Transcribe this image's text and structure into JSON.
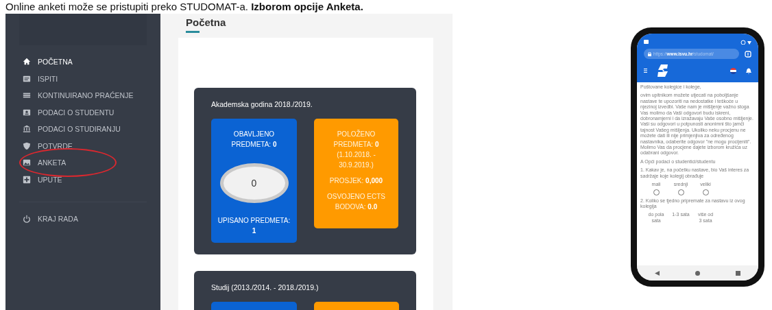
{
  "caption": "Online anketi može se pristupiti preko STUDOMAT-a. **Izborom opcije Anketa.**",
  "sidebar": {
    "items": [
      {
        "label": "POČETNA",
        "selected": true,
        "circled": false
      },
      {
        "label": "ISPITI",
        "selected": false,
        "circled": false
      },
      {
        "label": "KONTINUIRANO PRAĆENJE",
        "selected": false,
        "circled": false
      },
      {
        "label": "PODACI O STUDENTU",
        "selected": false,
        "circled": false
      },
      {
        "label": "PODACI O STUDIRANJU",
        "selected": false,
        "circled": false
      },
      {
        "label": "POTVRDE",
        "selected": false,
        "circled": false
      },
      {
        "label": "ANKETA",
        "selected": false,
        "circled": true
      },
      {
        "label": "UPUTE",
        "selected": false,
        "circled": false
      }
    ],
    "footer_item": {
      "label": "KRAJ RADA"
    }
  },
  "page_title": "Početna",
  "cards": [
    {
      "title": "Akademska godina 2018./2019.",
      "tiles": [
        {
          "kind": "ring",
          "color": "#0b63d3",
          "top": "OBAVLJENO PREDMETA: **0**",
          "ring_value": "0",
          "bottom": "UPISANO PREDMETA: **1**"
        },
        {
          "kind": "stats",
          "color": "#ff9a00",
          "lines": [
            "POLOŽENO PREDMETA: **0** (1.10.2018. - 30.9.2019.)",
            "PROSJEK: **0,000**",
            "OSVOJENO ECTS BODOVA: **0.0**"
          ]
        }
      ]
    },
    {
      "title": "Studij (2013./2014. - 2018./2019.)",
      "tiles": [
        {
          "kind": "empty",
          "color": "#0b63d3"
        },
        {
          "kind": "empty",
          "color": "#ff9a00"
        }
      ]
    }
  ],
  "phone": {
    "url": "https://**www.isvu.hr**/studomat/",
    "greeting": "Poštovane kolegice i kolege,",
    "intro": "ovim upitnikom možete utjecati na poboljšanje nastave te upozoriti na nedostatke i teškoće u njezinoj izvedbi. Vaše nam je mišljenje važno stoga Vas molimo da Vaši odgovori budu iskreni, dobronamjerni i da izražavaju Vaše osobno mišljenje. Vaši su odgovori u potpunosti anonimni što jamči tajnost Vašeg mišljenja. Ukoliko neku procjenu ne možete dati ili nije primjenjiva za određenog nastavnika, odaberite odgovor \"ne mogu procijeniti\". Molimo Vas da procjene dajete izborom kružića uz odabrani odgovor.",
    "section": "A Opći podaci o studentici/studentu",
    "questions": [
      {
        "text": "1. Kakav je, na početku nastave, bio Vaš interes za sadržaje koje kolegij obrađuje",
        "options": [
          {
            "label": "mali",
            "selected": false
          },
          {
            "label": "srednji",
            "selected": false
          },
          {
            "label": "veliki",
            "selected": false
          }
        ]
      },
      {
        "text": "2. Koliko se tjedno pripremate za nastavu iz ovog kolegija",
        "options": [
          {
            "label": "do pola sata"
          },
          {
            "label": "1-3 sata"
          },
          {
            "label": "više od 3 sata"
          }
        ]
      }
    ]
  }
}
